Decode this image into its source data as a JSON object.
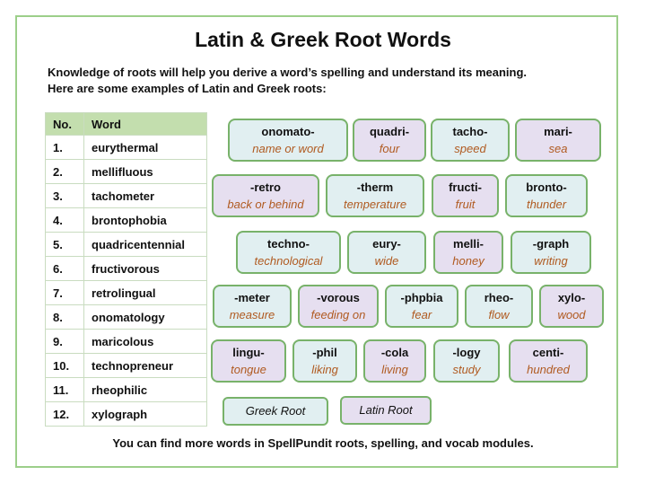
{
  "title": "Latin & Greek Root Words",
  "intro": {
    "line1": "Knowledge of roots will help you derive a word’s spelling and understand its meaning.",
    "line2": "Here are some examples of Latin and Greek roots:"
  },
  "table": {
    "headers": [
      "No.",
      "Word"
    ],
    "rows": [
      [
        "1.",
        "eurythermal"
      ],
      [
        "2.",
        "mellifluous"
      ],
      [
        "3.",
        "tachometer"
      ],
      [
        "4.",
        "brontophobia"
      ],
      [
        "5.",
        "quadricentennial"
      ],
      [
        "6.",
        "fructivorous"
      ],
      [
        "7.",
        "retrolingual"
      ],
      [
        "8.",
        "onomatology"
      ],
      [
        "9.",
        "maricolous"
      ],
      [
        "10.",
        "technopreneur"
      ],
      [
        "11.",
        "rheophilic"
      ],
      [
        "12.",
        "xylograph"
      ]
    ]
  },
  "roots": [
    {
      "root": "onomato-",
      "meaning": "name or word",
      "origin": "greek"
    },
    {
      "root": "quadri-",
      "meaning": "four",
      "origin": "latin"
    },
    {
      "root": "tacho-",
      "meaning": "speed",
      "origin": "greek"
    },
    {
      "root": "mari-",
      "meaning": "sea",
      "origin": "latin"
    },
    {
      "root": "-retro",
      "meaning": "back or behind",
      "origin": "latin"
    },
    {
      "root": "-therm",
      "meaning": "temperature",
      "origin": "greek"
    },
    {
      "root": "fructi-",
      "meaning": "fruit",
      "origin": "latin"
    },
    {
      "root": "bronto-",
      "meaning": "thunder",
      "origin": "greek"
    },
    {
      "root": "techno-",
      "meaning": "technological",
      "origin": "greek"
    },
    {
      "root": "eury-",
      "meaning": "wide",
      "origin": "greek"
    },
    {
      "root": "melli-",
      "meaning": "honey",
      "origin": "latin"
    },
    {
      "root": "-graph",
      "meaning": "writing",
      "origin": "greek"
    },
    {
      "root": "-meter",
      "meaning": "measure",
      "origin": "greek"
    },
    {
      "root": "-vorous",
      "meaning": "feeding on",
      "origin": "latin"
    },
    {
      "root": "-phpbia",
      "meaning": "fear",
      "origin": "greek"
    },
    {
      "root": "rheo-",
      "meaning": "flow",
      "origin": "greek"
    },
    {
      "root": "xylo-",
      "meaning": "wood",
      "origin": "latin"
    },
    {
      "root": "lingu-",
      "meaning": "tongue",
      "origin": "latin"
    },
    {
      "root": "-phil",
      "meaning": "liking",
      "origin": "greek"
    },
    {
      "root": "-cola",
      "meaning": "living",
      "origin": "latin"
    },
    {
      "root": "-logy",
      "meaning": "study",
      "origin": "greek"
    },
    {
      "root": "centi-",
      "meaning": "hundred",
      "origin": "latin"
    }
  ],
  "legend": {
    "greek_label": "Greek Root",
    "latin_label": "Latin Root"
  },
  "colors": {
    "greek": "#e1eff1",
    "latin": "#e6dff0",
    "border": "#78b26a",
    "meaning": "#b05a20",
    "table_header": "#c3deae"
  },
  "footer": "You can find more words in SpellPundit roots, spelling, and vocab modules."
}
